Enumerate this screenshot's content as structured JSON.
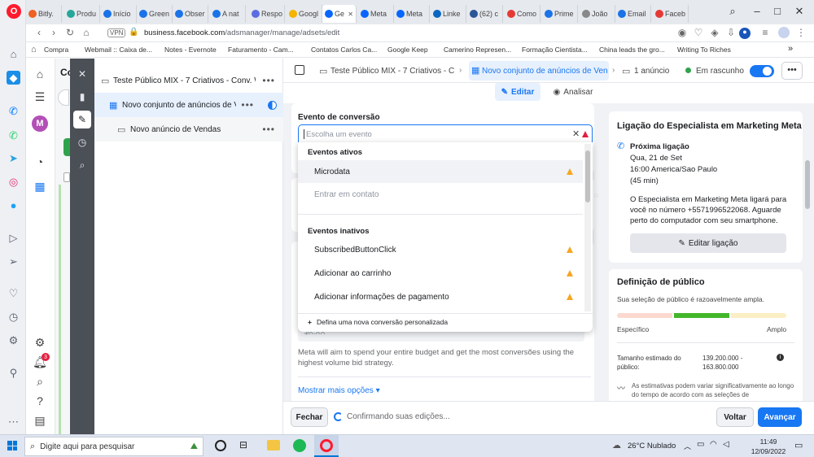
{
  "browser": {
    "tabs": [
      {
        "label": "Bitly.",
        "color": "#ee6123"
      },
      {
        "label": "Produ",
        "color": "#26a69a"
      },
      {
        "label": "Início",
        "color": "#1a73e8"
      },
      {
        "label": "Green",
        "color": "#1a73e8"
      },
      {
        "label": "Obser",
        "color": "#1a73e8"
      },
      {
        "label": "A nat",
        "color": "#1a73e8"
      },
      {
        "label": "Respo",
        "color": "#5b6ee1"
      },
      {
        "label": "Googl",
        "color": "#f4b400"
      },
      {
        "label": "Ge",
        "color": "#0866ff"
      },
      {
        "label": "Meta",
        "color": "#0866ff"
      },
      {
        "label": "Meta",
        "color": "#0866ff"
      },
      {
        "label": "Linke",
        "color": "#0a66c2"
      },
      {
        "label": "(62) c",
        "color": "#2b5797"
      },
      {
        "label": "Como",
        "color": "#e53935"
      },
      {
        "label": "Prime",
        "color": "#1a73e8"
      },
      {
        "label": "João",
        "color": "#888888"
      },
      {
        "label": "Email",
        "color": "#1a73e8"
      },
      {
        "label": "Faceb",
        "color": "#e53935"
      }
    ],
    "url_domain": "business.facebook.com",
    "url_path": "/adsmanager/manage/adsets/edit",
    "vpn_label": "VPN",
    "bookmarks": [
      "Compra",
      "Webmail :: Caixa de...",
      "Notes - Evernote",
      "Faturamento - Cam...",
      "Contatos Carlos Ca...",
      "Google Keep",
      "Camerino Represen...",
      "Formação Cientista...",
      "China leads the gro...",
      "Writing To Riches"
    ]
  },
  "avatar_letter": "M",
  "notification_count": "3",
  "tree": {
    "campaign": "Teste Público MIX - 7 Criativos - Conv. W...",
    "adset": "Novo conjunto de anúncios de V...",
    "ad": "Novo anúncio de Vendas"
  },
  "left_clipped": {
    "header": "Co"
  },
  "header": {
    "breadcrumb_campaign": "Teste Público MIX - 7 Criativos - Conv",
    "breadcrumb_adset": "Novo conjunto de anúncios de Venda",
    "breadcrumb_ad": "1 anúncio",
    "status": "Em rascunho",
    "toggle_on": true
  },
  "edit_tabs": {
    "edit": "Editar",
    "review": "Analisar"
  },
  "conversion": {
    "label": "Evento de conversão",
    "placeholder": "Escolha um evento",
    "active_header": "Eventos ativos",
    "active_events": [
      {
        "label": "Microdata",
        "warning": true
      },
      {
        "label": "Entrar em contato",
        "warning": false
      }
    ],
    "inactive_header": "Eventos inativos",
    "inactive_events": [
      {
        "label": "SubscribedButtonClick",
        "warning": true
      },
      {
        "label": "Adicionar ao carrinho",
        "warning": true
      },
      {
        "label": "Adicionar informações de pagamento",
        "warning": true
      }
    ],
    "custom_conversion": "Defina uma nova conversão personalizada"
  },
  "budget": {
    "cost_placeholder": "$X.XX",
    "strategy_text": "Meta will aim to spend your entire budget and get the most conversões using the highest volume bid strategy.",
    "more_options": "Mostrar mais opções"
  },
  "specialist": {
    "title": "Ligação do Especialista em Marketing Meta",
    "next_call_label": "Próxima ligação",
    "date": "Qua, 21 de Set",
    "time": "16:00 America/Sao Paulo",
    "duration": "(45 min)",
    "description": "O Especialista em Marketing Meta ligará para você no número +5571996522068. Aguarde perto do computador com seu smartphone.",
    "edit_button": "Editar ligação"
  },
  "audience": {
    "title": "Definição de público",
    "subtitle": "Sua seleção de público é razoavelmente ampla.",
    "min_label": "Específico",
    "max_label": "Amplo",
    "size_label": "Tamanho estimado do público:",
    "size_value": "139.200.000 - 163.800.000",
    "note": "As estimativas podem variar significativamente ao longo do tempo de acordo com as seleções de"
  },
  "footer": {
    "close": "Fechar",
    "status": "Confirmando suas edições...",
    "back": "Voltar",
    "next": "Avançar"
  },
  "taskbar": {
    "search_placeholder": "Digite aqui para pesquisar",
    "weather": "26°C Nublado",
    "time": "11:49",
    "date": "12/09/2022"
  },
  "colors": {
    "accent": "#1877f2",
    "success": "#31a24c",
    "warning": "#f5a623"
  }
}
